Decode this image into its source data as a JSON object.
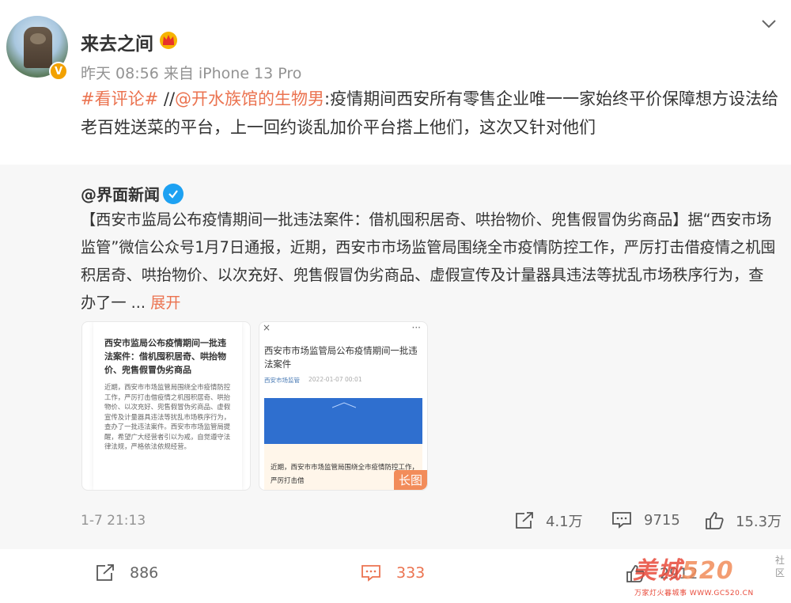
{
  "post": {
    "username": "来去之间",
    "meta_time": "昨天 08:56",
    "meta_source": "来自 iPhone 13 Pro",
    "hashtag": "#看评论#",
    "separator": " //",
    "mention": "@开水族馆的生物男",
    "text": ":疫情期间西安所有零售企业唯一一家始终平价保障想方设法给老百姓送菜的平台，上一回约谈乱加价平台搭上他们，这次又针对他们"
  },
  "repost": {
    "author": "@界面新闻",
    "text": "【西安市监局公布疫情期间一批违法案件：借机囤积居奇、哄抬物价、兜售假冒伪劣商品】据“西安市场监管”微信公众号1月7日通报，近期，西安市市场监管局围绕全市疫情防控工作，严厉打击借疫情之机囤积居奇、哄抬物价、以次充好、兜售假冒伪劣商品、虚假宣传及计量器具违法等扰乱市场秩序行为，查办了一 ... ",
    "expand_label": "展开",
    "image1": {
      "title": "西安市监局公布疫情期间一批违法案件：借机囤积居奇、哄抬物价、兜售假冒伪劣商品",
      "body": "近期，西安市市场监管局围绕全市疫情防控工作，严厉打击借疫情之机囤积居奇、哄抬物价、以次充好、兜售假冒伪劣商品、虚假宣传及计量器具违法等扰乱市场秩序行为，查办了一批违法案件。西安市市场监管局提醒，希望广大经营者引以为戒，自觉遵守法律法规，严格依法依规经营。"
    },
    "image2": {
      "close": "×",
      "more": "···",
      "title": "西安市市场监管局公布疫情期间一批违法案件",
      "source": "西安市场监管",
      "date": "2022-01-07 00:01",
      "card_text": "近期，西安市市场监管局围绕全市疫情防控工作，严厉打击借",
      "badge": "长图"
    },
    "time": "1-7 21:13",
    "share_count": "4.1万",
    "comment_count": "9715",
    "like_count": "15.3万"
  },
  "actions": {
    "share_count": "886",
    "comment_count": "333",
    "like_count": "2912"
  },
  "watermark": {
    "big": "美城",
    "num": "520",
    "side": "社区",
    "small": "万家灯火暮城事 WWW.GC520.CN"
  },
  "colors": {
    "link": "#eb7350",
    "verified_orange": "#f2a100",
    "verified_blue": "#1da1f2"
  }
}
